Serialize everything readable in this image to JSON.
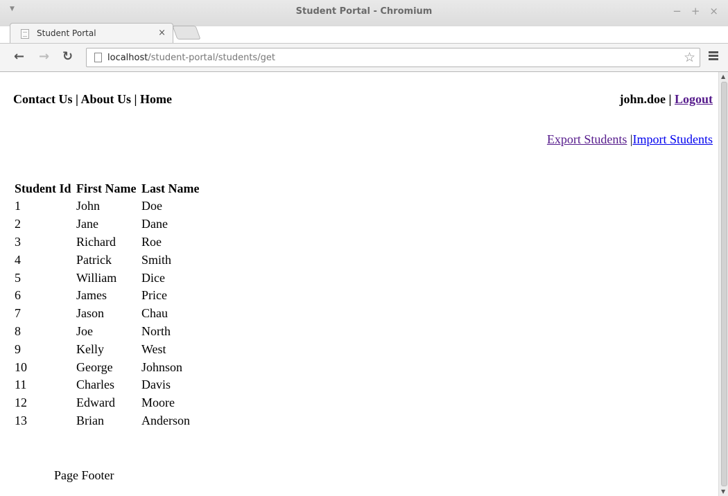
{
  "window": {
    "title": "Student Portal - Chromium",
    "controls": [
      "−",
      "+",
      "×"
    ]
  },
  "tab": {
    "title": "Student Portal",
    "close": "×"
  },
  "toolbar": {
    "url_host": "localhost",
    "url_path": "/student-portal/students/get"
  },
  "nav": {
    "contact": "Contact Us",
    "sep1": " | ",
    "about": "About Us",
    "sep2": " | ",
    "home": "Home"
  },
  "user": {
    "name": "john.doe",
    "sep": " | ",
    "logout": "Logout"
  },
  "actions": {
    "export": "Export Students",
    "sep": " |",
    "import": "Import Students"
  },
  "table": {
    "headers": [
      "Student Id",
      "First Name",
      "Last Name"
    ],
    "rows": [
      [
        "1",
        "John",
        "Doe"
      ],
      [
        "2",
        "Jane",
        "Dane"
      ],
      [
        "3",
        "Richard",
        "Roe"
      ],
      [
        "4",
        "Patrick",
        "Smith"
      ],
      [
        "5",
        "William",
        "Dice"
      ],
      [
        "6",
        "James",
        "Price"
      ],
      [
        "7",
        "Jason",
        "Chau"
      ],
      [
        "8",
        "Joe",
        "North"
      ],
      [
        "9",
        "Kelly",
        "West"
      ],
      [
        "10",
        "George",
        "Johnson"
      ],
      [
        "11",
        "Charles",
        "Davis"
      ],
      [
        "12",
        "Edward",
        "Moore"
      ],
      [
        "13",
        "Brian",
        "Anderson"
      ]
    ]
  },
  "footer": {
    "text": "Page Footer"
  },
  "icons": {
    "back": "←",
    "forward": "→",
    "reload": "↻",
    "star": "☆",
    "window_menu": "▼"
  }
}
